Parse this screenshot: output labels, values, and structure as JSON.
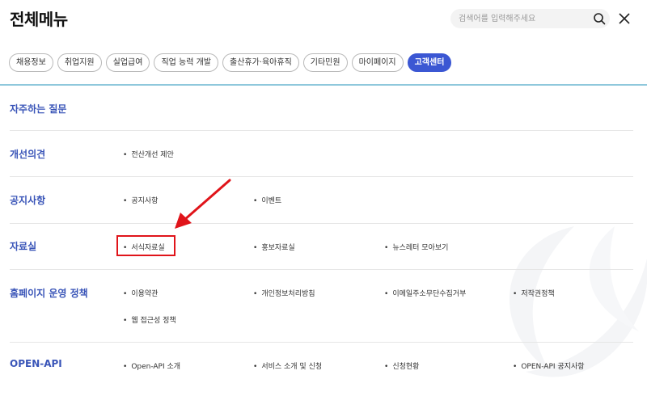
{
  "header": {
    "title": "전체메뉴",
    "search_placeholder": "검색어를 입력해주세요"
  },
  "icons": {
    "search": "search-icon",
    "close": "close-icon"
  },
  "tabs": [
    {
      "label": "채용정보"
    },
    {
      "label": "취업지원"
    },
    {
      "label": "실업급여"
    },
    {
      "label": "직업 능력 개발"
    },
    {
      "label": "출산휴가·육아휴직"
    },
    {
      "label": "기타민원"
    },
    {
      "label": "마이페이지"
    },
    {
      "label": "고객센터",
      "active": true
    }
  ],
  "sections": [
    {
      "title": "자주하는 질문",
      "items": []
    },
    {
      "title": "개선의견",
      "items": [
        "전산개선 제안"
      ]
    },
    {
      "title": "공지사항",
      "items": [
        "공지사항",
        "이벤트"
      ]
    },
    {
      "title": "자료실",
      "items": [
        "서식자료실",
        "홍보자료실",
        "뉴스레터 모아보기"
      ]
    },
    {
      "title": "홈페이지 운영 정책",
      "items": [
        "이용약관",
        "개인정보처리방침",
        "이메일주소무단수집거부",
        "저작권정책",
        "웹 접근성 정책"
      ]
    },
    {
      "title": "OPEN-API",
      "items": [
        "Open-API 소개",
        "서비스 소개 및 신청",
        "신청현황",
        "OPEN-API 공지사항"
      ]
    }
  ],
  "bullet": "•",
  "colors": {
    "accent": "#3b57d3",
    "section_title": "#3a55b8",
    "highlight": "#e0141a",
    "divider": "#8fc8dc"
  }
}
